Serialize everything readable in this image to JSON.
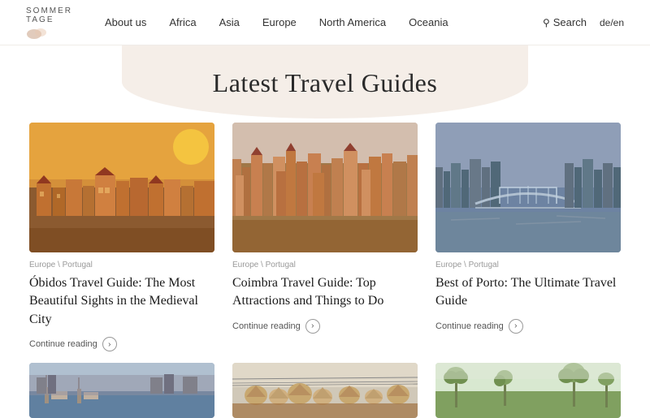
{
  "nav": {
    "logo_line1": "SOMMER",
    "logo_line2": "TAGE",
    "links": [
      {
        "label": "About us",
        "id": "about-us"
      },
      {
        "label": "Africa",
        "id": "africa"
      },
      {
        "label": "Asia",
        "id": "asia"
      },
      {
        "label": "Europe",
        "id": "europe"
      },
      {
        "label": "North America",
        "id": "north-america"
      },
      {
        "label": "Oceania",
        "id": "oceania"
      }
    ],
    "search_label": "Search",
    "lang_label": "de/en"
  },
  "hero": {
    "title": "Latest Travel Guides"
  },
  "cards": [
    {
      "category": "Europe \\ Portugal",
      "title": "Óbidos Travel Guide: The Most Beautiful Sights in the Medieval City",
      "read_more": "Continue reading",
      "colors": {
        "sky": "#e8a840",
        "city": "#b07840",
        "dark": "#703820",
        "ground": "#8b5a30"
      }
    },
    {
      "category": "Europe \\ Portugal",
      "title": "Coimbra Travel Guide: Top Attractions and Things to Do",
      "read_more": "Continue reading",
      "colors": {
        "sky": "#c8b8a0",
        "city": "#c07840",
        "dark": "#906040",
        "ground": "#7a4820"
      }
    },
    {
      "category": "Europe \\ Portugal",
      "title": "Best of Porto: The Ultimate Travel Guide",
      "read_more": "Continue reading",
      "colors": {
        "sky": "#8090a8",
        "city": "#788898",
        "dark": "#506070",
        "water": "#708090",
        "bridge": "#a0b0c0"
      }
    }
  ],
  "bottom_cards": [
    {
      "colors": {
        "sky": "#8098b0",
        "water": "#6080a0",
        "land": "#708890"
      }
    },
    {
      "colors": {
        "sky": "#d0c8b8",
        "roofs": "#c8a870",
        "ground": "#a07040"
      }
    },
    {
      "colors": {
        "sky": "#c8d8c0",
        "tree": "#80a070",
        "ground": "#708060"
      }
    }
  ]
}
